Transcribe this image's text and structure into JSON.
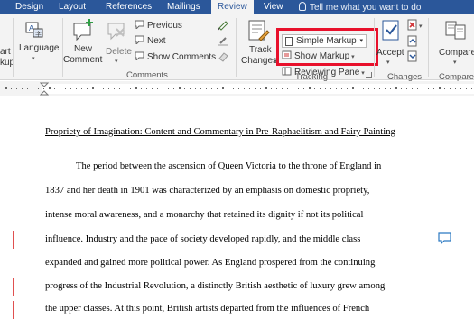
{
  "tabs": [
    {
      "label": "Design"
    },
    {
      "label": "Layout"
    },
    {
      "label": "References"
    },
    {
      "label": "Mailings"
    },
    {
      "label": "Review"
    },
    {
      "label": "View"
    }
  ],
  "tell_me": "Tell me what you want to do",
  "ribbon": {
    "smart_lookup_fragment": "art\nkup",
    "language": "Language",
    "new_comment": [
      "New",
      "Comment"
    ],
    "delete": "Delete",
    "previous": "Previous",
    "next": "Next",
    "show_comments": "Show Comments",
    "comments_group": "Comments",
    "track_changes": [
      "Track",
      "Changes"
    ],
    "markup_select": "Simple Markup",
    "show_markup": "Show Markup",
    "reviewing_pane": "Reviewing Pane",
    "tracking_group": "Tracking",
    "accept": "Accept",
    "changes_group": "Changes",
    "compare": "Compare",
    "compare_group": "Compare"
  },
  "document": {
    "title": "Propriety of Imagination: Content and Commentary in Pre-Raphaelitism and Fairy Painting",
    "lines": [
      "The period between the ascension of Queen Victoria to the throne of England in",
      "1837 and her death in 1901 was characterized by an emphasis on domestic propriety,",
      "intense moral awareness, and a monarchy that retained its dignity if not its political",
      "influence. Industry and the pace of society developed rapidly, and the middle class",
      "expanded and gained more political power. As England prospered from the continuing",
      "progress of the Industrial Revolution, a distinctly British aesthetic of luxury grew among",
      "the upper classes. At this point, British artists departed from the influences of French"
    ]
  },
  "colors": {
    "tab_bar": "#2b579a",
    "highlight": "#e8102b",
    "change_bar": "#e05050"
  }
}
